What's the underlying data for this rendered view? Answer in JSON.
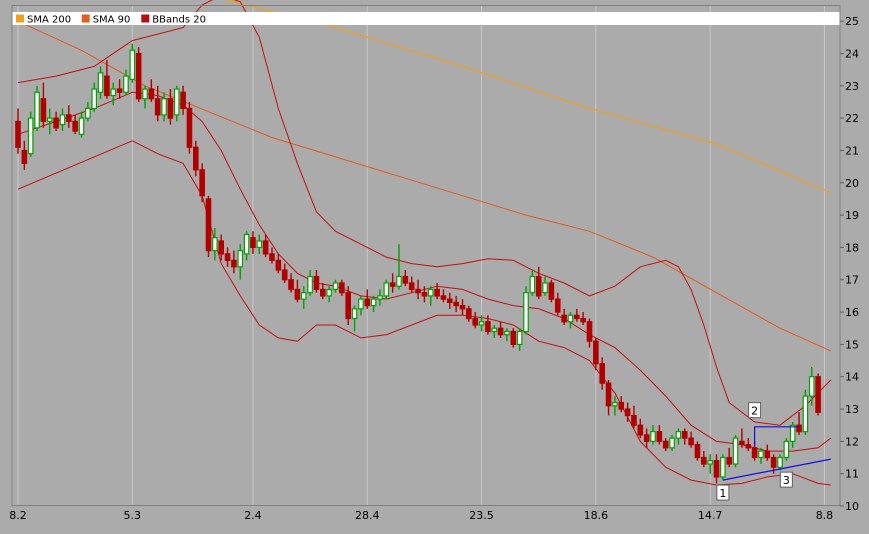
{
  "chart_data": {
    "type": "candlestick",
    "legend": [
      {
        "name": "SMA 200",
        "color": "#f0a020"
      },
      {
        "name": "SMA 90",
        "color": "#e06020"
      },
      {
        "name": "BBands 20",
        "color": "#b01010"
      }
    ],
    "x_ticks": [
      {
        "label": "8.2",
        "index": 0
      },
      {
        "label": "5.3",
        "index": 18
      },
      {
        "label": "2.4",
        "index": 37
      },
      {
        "label": "28.4",
        "index": 55
      },
      {
        "label": "23.5",
        "index": 73
      },
      {
        "label": "18.6",
        "index": 91
      },
      {
        "label": "14.7",
        "index": 109
      },
      {
        "label": "8.8",
        "index": 127
      }
    ],
    "ylim": [
      10,
      25.5
    ],
    "y_ticks": [
      10,
      11,
      12,
      13,
      14,
      15,
      16,
      17,
      18,
      19,
      20,
      21,
      22,
      23,
      24,
      25
    ],
    "colors": {
      "up": "#00a000",
      "down": "#b00000",
      "bb": "#c01010",
      "sma90": "#e05a20",
      "sma200": "#f0a020",
      "trend": "#1010e0",
      "grid": "#c8c8c8",
      "plot_bg": "#ababab"
    },
    "candles": [
      [
        21.9,
        22.3,
        20.9,
        21.1
      ],
      [
        21.0,
        21.3,
        20.4,
        20.6
      ],
      [
        20.9,
        22.2,
        20.8,
        22.0
      ],
      [
        21.7,
        23.0,
        21.6,
        22.8
      ],
      [
        22.6,
        23.1,
        21.7,
        21.9
      ],
      [
        21.9,
        22.3,
        21.5,
        22.0
      ],
      [
        22.0,
        22.2,
        21.6,
        21.7
      ],
      [
        21.8,
        22.3,
        21.6,
        22.1
      ],
      [
        22.1,
        22.4,
        21.7,
        21.9
      ],
      [
        21.9,
        22.1,
        21.5,
        21.6
      ],
      [
        21.5,
        22.2,
        21.4,
        22.0
      ],
      [
        22.0,
        22.5,
        21.9,
        22.3
      ],
      [
        22.3,
        23.1,
        22.2,
        22.9
      ],
      [
        22.8,
        23.6,
        22.6,
        23.4
      ],
      [
        23.3,
        23.8,
        22.6,
        22.7
      ],
      [
        22.7,
        23.1,
        22.4,
        22.9
      ],
      [
        22.9,
        23.2,
        22.6,
        22.8
      ],
      [
        22.8,
        23.5,
        22.7,
        23.3
      ],
      [
        23.2,
        24.3,
        23.1,
        24.1
      ],
      [
        24.0,
        24.2,
        22.5,
        22.6
      ],
      [
        22.6,
        23.0,
        22.3,
        22.9
      ],
      [
        22.9,
        23.2,
        22.5,
        22.6
      ],
      [
        22.6,
        23.0,
        21.9,
        22.1
      ],
      [
        22.1,
        22.8,
        21.9,
        22.6
      ],
      [
        22.6,
        22.9,
        21.8,
        22.0
      ],
      [
        22.1,
        23.0,
        21.9,
        22.9
      ],
      [
        22.8,
        23.0,
        22.1,
        22.3
      ],
      [
        22.3,
        22.5,
        20.9,
        21.1
      ],
      [
        21.1,
        21.3,
        20.2,
        20.4
      ],
      [
        20.4,
        20.6,
        19.4,
        19.6
      ],
      [
        19.5,
        19.6,
        17.7,
        17.9
      ],
      [
        17.9,
        18.6,
        17.6,
        18.3
      ],
      [
        18.2,
        18.4,
        17.6,
        17.8
      ],
      [
        17.8,
        18.0,
        17.4,
        17.6
      ],
      [
        17.6,
        17.9,
        17.2,
        17.4
      ],
      [
        17.4,
        18.1,
        17.0,
        17.9
      ],
      [
        17.8,
        18.5,
        17.6,
        18.4
      ],
      [
        18.3,
        18.5,
        17.8,
        18.0
      ],
      [
        18.0,
        18.4,
        17.8,
        18.2
      ],
      [
        18.2,
        18.4,
        17.7,
        17.8
      ],
      [
        17.8,
        18.0,
        17.5,
        17.6
      ],
      [
        17.6,
        17.8,
        17.2,
        17.3
      ],
      [
        17.3,
        17.5,
        16.9,
        17.0
      ],
      [
        17.0,
        17.2,
        16.6,
        16.7
      ],
      [
        16.7,
        17.0,
        16.3,
        16.4
      ],
      [
        16.4,
        16.8,
        16.1,
        16.6
      ],
      [
        16.6,
        17.3,
        16.5,
        17.1
      ],
      [
        17.1,
        17.3,
        16.6,
        16.7
      ],
      [
        16.7,
        16.9,
        16.4,
        16.5
      ],
      [
        16.5,
        16.8,
        16.3,
        16.7
      ],
      [
        16.7,
        17.0,
        16.6,
        16.9
      ],
      [
        16.9,
        17.0,
        16.5,
        16.6
      ],
      [
        16.6,
        16.8,
        15.6,
        15.8
      ],
      [
        15.8,
        16.2,
        15.4,
        16.1
      ],
      [
        16.1,
        16.5,
        15.9,
        16.4
      ],
      [
        16.4,
        16.7,
        16.1,
        16.2
      ],
      [
        16.2,
        16.5,
        16.0,
        16.4
      ],
      [
        16.4,
        16.7,
        16.2,
        16.5
      ],
      [
        16.5,
        17.0,
        16.4,
        16.9
      ],
      [
        16.9,
        17.2,
        16.6,
        16.8
      ],
      [
        16.8,
        18.1,
        16.7,
        17.1
      ],
      [
        17.1,
        17.3,
        16.8,
        16.9
      ],
      [
        16.9,
        17.1,
        16.6,
        16.7
      ],
      [
        16.7,
        17.0,
        16.4,
        16.6
      ],
      [
        16.6,
        16.8,
        16.3,
        16.5
      ],
      [
        16.5,
        16.8,
        16.2,
        16.7
      ],
      [
        16.7,
        16.9,
        16.4,
        16.5
      ],
      [
        16.5,
        16.7,
        16.3,
        16.4
      ],
      [
        16.4,
        16.6,
        16.1,
        16.3
      ],
      [
        16.3,
        16.5,
        16.0,
        16.2
      ],
      [
        16.2,
        16.4,
        15.9,
        16.1
      ],
      [
        16.1,
        16.2,
        15.7,
        15.8
      ],
      [
        15.8,
        16.0,
        15.5,
        15.6
      ],
      [
        15.6,
        15.9,
        15.4,
        15.7
      ],
      [
        15.7,
        15.9,
        15.3,
        15.4
      ],
      [
        15.4,
        15.6,
        15.2,
        15.5
      ],
      [
        15.5,
        15.7,
        15.2,
        15.3
      ],
      [
        15.3,
        15.5,
        15.1,
        15.4
      ],
      [
        15.4,
        15.5,
        14.9,
        15.0
      ],
      [
        15.0,
        15.5,
        14.8,
        15.4
      ],
      [
        15.4,
        16.8,
        15.3,
        16.6
      ],
      [
        16.6,
        17.3,
        16.5,
        17.1
      ],
      [
        17.1,
        17.4,
        16.4,
        16.5
      ],
      [
        16.6,
        17.1,
        16.5,
        16.9
      ],
      [
        16.9,
        17.0,
        16.3,
        16.4
      ],
      [
        16.4,
        16.6,
        15.9,
        16.0
      ],
      [
        15.9,
        16.1,
        15.6,
        15.7
      ],
      [
        15.7,
        16.0,
        15.5,
        15.9
      ],
      [
        15.9,
        16.1,
        15.7,
        15.8
      ],
      [
        15.8,
        16.0,
        15.6,
        15.7
      ],
      [
        15.7,
        15.8,
        14.9,
        15.1
      ],
      [
        15.1,
        15.2,
        14.2,
        14.4
      ],
      [
        14.4,
        14.6,
        13.6,
        13.8
      ],
      [
        13.8,
        13.9,
        12.8,
        13.1
      ],
      [
        13.1,
        13.4,
        12.8,
        13.2
      ],
      [
        13.2,
        13.4,
        12.9,
        13.0
      ],
      [
        13.0,
        13.2,
        12.6,
        12.8
      ],
      [
        12.8,
        13.1,
        12.4,
        12.5
      ],
      [
        12.5,
        12.7,
        12.1,
        12.2
      ],
      [
        12.2,
        12.4,
        11.8,
        12.0
      ],
      [
        12.0,
        12.5,
        11.9,
        12.3
      ],
      [
        12.3,
        12.5,
        11.9,
        12.0
      ],
      [
        12.0,
        12.1,
        11.7,
        11.8
      ],
      [
        11.8,
        12.2,
        11.7,
        12.1
      ],
      [
        12.1,
        12.4,
        11.9,
        12.3
      ],
      [
        12.3,
        12.4,
        11.9,
        12.1
      ],
      [
        12.1,
        12.3,
        11.8,
        11.9
      ],
      [
        11.9,
        12.0,
        11.4,
        11.5
      ],
      [
        11.5,
        11.7,
        11.2,
        11.3
      ],
      [
        11.3,
        11.6,
        11.0,
        11.4
      ],
      [
        11.4,
        11.6,
        10.7,
        10.9
      ],
      [
        10.9,
        11.6,
        10.8,
        11.5
      ],
      [
        11.5,
        11.8,
        11.2,
        11.3
      ],
      [
        11.3,
        12.2,
        11.2,
        12.1
      ],
      [
        12.0,
        12.4,
        11.8,
        11.9
      ],
      [
        11.9,
        12.1,
        11.7,
        11.8
      ],
      [
        11.8,
        12.0,
        11.4,
        11.5
      ],
      [
        11.5,
        11.8,
        11.3,
        11.7
      ],
      [
        11.7,
        11.9,
        11.4,
        11.5
      ],
      [
        11.5,
        11.6,
        11.0,
        11.2
      ],
      [
        11.2,
        11.6,
        11.1,
        11.5
      ],
      [
        11.5,
        12.1,
        11.4,
        12.0
      ],
      [
        12.0,
        12.6,
        11.8,
        12.5
      ],
      [
        12.5,
        12.9,
        12.2,
        12.3
      ],
      [
        12.3,
        13.6,
        12.2,
        13.4
      ],
      [
        13.4,
        14.3,
        13.1,
        14.0
      ],
      [
        14.0,
        14.1,
        12.8,
        12.9
      ]
    ],
    "bb_upper_pts": [
      [
        0,
        23.1
      ],
      [
        6,
        23.3
      ],
      [
        12,
        23.6
      ],
      [
        18,
        24.4
      ],
      [
        22,
        24.6
      ],
      [
        26,
        24.8
      ],
      [
        29,
        25.5
      ],
      [
        32,
        25.8
      ],
      [
        35,
        25.6
      ],
      [
        38,
        24.5
      ],
      [
        41,
        22.3
      ],
      [
        44,
        20.6
      ],
      [
        47,
        19.1
      ],
      [
        50,
        18.5
      ],
      [
        54,
        18.1
      ],
      [
        58,
        17.7
      ],
      [
        62,
        17.5
      ],
      [
        66,
        17.4
      ],
      [
        70,
        17.5
      ],
      [
        74,
        17.65
      ],
      [
        78,
        17.6
      ],
      [
        82,
        17.2
      ],
      [
        86,
        16.9
      ],
      [
        90,
        16.5
      ],
      [
        94,
        16.8
      ],
      [
        98,
        17.4
      ],
      [
        102,
        17.6
      ],
      [
        104,
        17.4
      ],
      [
        106,
        16.7
      ],
      [
        108,
        15.6
      ],
      [
        110,
        14.3
      ],
      [
        112,
        13.2
      ],
      [
        116,
        12.6
      ],
      [
        120,
        12.5
      ],
      [
        124,
        13.1
      ],
      [
        128,
        13.9
      ]
    ],
    "bb_middle_pts": [
      [
        0,
        21.5
      ],
      [
        6,
        21.9
      ],
      [
        12,
        22.3
      ],
      [
        18,
        22.8
      ],
      [
        22,
        22.7
      ],
      [
        26,
        22.4
      ],
      [
        29,
        21.9
      ],
      [
        32,
        21.0
      ],
      [
        35,
        19.8
      ],
      [
        38,
        18.7
      ],
      [
        41,
        17.8
      ],
      [
        44,
        17.2
      ],
      [
        47,
        16.9
      ],
      [
        50,
        16.8
      ],
      [
        54,
        16.5
      ],
      [
        58,
        16.4
      ],
      [
        62,
        16.6
      ],
      [
        66,
        16.8
      ],
      [
        70,
        16.7
      ],
      [
        74,
        16.4
      ],
      [
        78,
        16.2
      ],
      [
        82,
        16.1
      ],
      [
        86,
        15.8
      ],
      [
        90,
        15.3
      ],
      [
        94,
        14.9
      ],
      [
        98,
        14.2
      ],
      [
        102,
        13.4
      ],
      [
        106,
        12.5
      ],
      [
        110,
        12.0
      ],
      [
        114,
        11.9
      ],
      [
        118,
        11.7
      ],
      [
        122,
        11.7
      ],
      [
        126,
        11.8
      ],
      [
        128,
        12.1
      ]
    ],
    "bb_lower_pts": [
      [
        0,
        19.8
      ],
      [
        6,
        20.3
      ],
      [
        12,
        20.8
      ],
      [
        18,
        21.3
      ],
      [
        22,
        20.9
      ],
      [
        26,
        20.6
      ],
      [
        29,
        19.6
      ],
      [
        32,
        17.5
      ],
      [
        35,
        16.5
      ],
      [
        38,
        15.6
      ],
      [
        41,
        15.2
      ],
      [
        44,
        15.1
      ],
      [
        47,
        15.6
      ],
      [
        50,
        15.6
      ],
      [
        54,
        15.2
      ],
      [
        58,
        15.3
      ],
      [
        62,
        15.6
      ],
      [
        66,
        15.9
      ],
      [
        70,
        15.9
      ],
      [
        74,
        15.8
      ],
      [
        78,
        15.6
      ],
      [
        82,
        15.1
      ],
      [
        86,
        14.9
      ],
      [
        90,
        14.5
      ],
      [
        94,
        13.5
      ],
      [
        98,
        12.0
      ],
      [
        102,
        11.2
      ],
      [
        106,
        10.8
      ],
      [
        110,
        10.65
      ],
      [
        114,
        10.7
      ],
      [
        118,
        10.9
      ],
      [
        122,
        11.0
      ],
      [
        126,
        10.7
      ],
      [
        128,
        10.65
      ]
    ],
    "sma90_pts": [
      [
        0,
        25.0
      ],
      [
        10,
        24.1
      ],
      [
        20,
        23.0
      ],
      [
        30,
        22.2
      ],
      [
        40,
        21.4
      ],
      [
        50,
        20.8
      ],
      [
        60,
        20.2
      ],
      [
        70,
        19.6
      ],
      [
        80,
        19.0
      ],
      [
        90,
        18.5
      ],
      [
        100,
        17.7
      ],
      [
        110,
        16.6
      ],
      [
        120,
        15.5
      ],
      [
        128,
        14.8
      ]
    ],
    "sma200_pts": [
      [
        30,
        25.8
      ],
      [
        50,
        24.8
      ],
      [
        70,
        23.6
      ],
      [
        90,
        22.3
      ],
      [
        110,
        21.2
      ],
      [
        128,
        19.7
      ]
    ],
    "trendlines": [
      {
        "points": [
          [
            111,
            10.8
          ],
          [
            128,
            11.45
          ]
        ]
      },
      {
        "points": [
          [
            116,
            11.85
          ],
          [
            116,
            12.45
          ],
          [
            123,
            12.45
          ]
        ]
      }
    ],
    "annotations": [
      {
        "label": "1",
        "index": 111,
        "value": 10.4
      },
      {
        "label": "2",
        "index": 116,
        "value": 12.95
      },
      {
        "label": "3",
        "index": 121,
        "value": 10.8
      }
    ]
  }
}
